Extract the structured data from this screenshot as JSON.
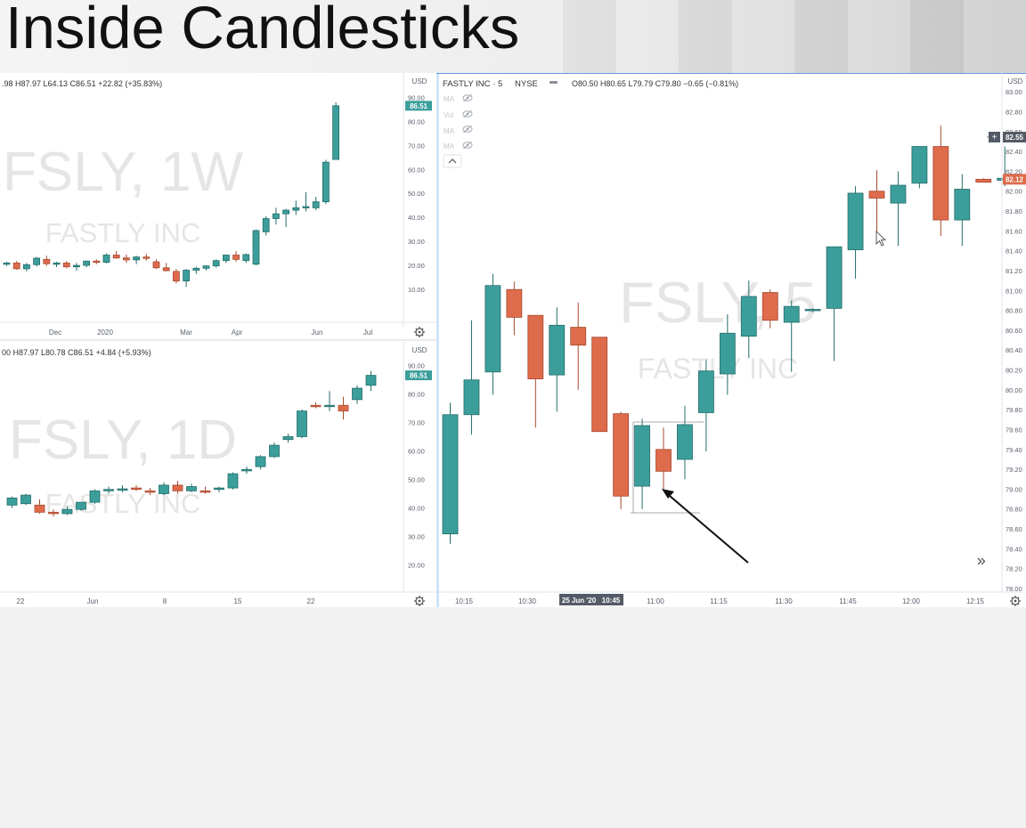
{
  "slide": {
    "title": "Inside Candlesticks"
  },
  "colors": {
    "up": "#3c9e9b",
    "down": "#de6b4b",
    "up_stroke": "#236d6a",
    "down_stroke": "#a84a31",
    "watermark": "#e5e5e5",
    "axis_text": "#59606b",
    "price_tag": "#3c9e9b",
    "current_tag": "#de6b4b",
    "crosshair_tag": "#545b66",
    "arrow": "#111111"
  },
  "panels": {
    "weekly": {
      "legend": ".98 H87.97 L64.13 C86.51 +22.82 (+35.83%)",
      "watermark_symbol": "FSLY, 1W",
      "watermark_name": "FASTLY INC",
      "currency": "USD",
      "price_tag": "86.51",
      "gear_icon": "gear"
    },
    "daily": {
      "legend": "00 H87.97 L80.78 C86.51 +4.84 (+5.93%)",
      "watermark_symbol": "FSLY, 1D",
      "watermark_name": "FASTLY INC",
      "currency": "USD",
      "price_tag": "86.51",
      "gear_icon": "gear"
    },
    "intraday": {
      "symbol": "FASTLY INC · 5",
      "exchange": "NYSE",
      "ohlc": "O80.50 H80.65 L79.79 C79.80 −0.65 (−0.81%)",
      "indicators": [
        "MA",
        "Vol",
        "MA",
        "MA"
      ],
      "watermark_symbol": "FSLY, 5",
      "watermark_name": "FASTLY INC",
      "currency": "USD",
      "crosshair_tag": "82.55",
      "price_tag": "82.12",
      "date_tag": "25 Jun '20",
      "time_tag": "10:45",
      "collapse_icon": "chevron-up",
      "scroll_icon": "double-chevron-right",
      "gear_icon": "gear"
    }
  },
  "chart_data": [
    {
      "type": "candlestick",
      "title": "FSLY, 1W",
      "ylabel": "USD",
      "ylim": [
        0,
        92
      ],
      "yticks": [
        "90.00",
        "80.00",
        "70.00",
        "60.00",
        "50.00",
        "40.00",
        "30.00",
        "20.00",
        "10.00"
      ],
      "xticks": [
        "Dec",
        "2020",
        "Mar",
        "Apr",
        "Jun",
        "Jul"
      ],
      "legend": "none",
      "candles": [
        [
          20.5,
          21.5,
          19.8,
          21.0
        ],
        [
          21.0,
          21.8,
          18.2,
          18.6
        ],
        [
          18.6,
          21.0,
          17.5,
          20.3
        ],
        [
          20.3,
          23.5,
          19.5,
          23.0
        ],
        [
          22.5,
          24.0,
          19.8,
          20.7
        ],
        [
          20.7,
          21.5,
          19.3,
          21.0
        ],
        [
          21.0,
          21.8,
          18.8,
          19.4
        ],
        [
          19.4,
          21.0,
          17.8,
          20.0
        ],
        [
          20.0,
          22.0,
          19.2,
          21.8
        ],
        [
          21.8,
          22.5,
          20.5,
          21.3
        ],
        [
          21.3,
          25.0,
          20.8,
          24.3
        ],
        [
          24.3,
          26.0,
          22.8,
          23.1
        ],
        [
          23.1,
          24.5,
          21.0,
          22.3
        ],
        [
          22.3,
          24.0,
          20.5,
          23.5
        ],
        [
          23.5,
          24.8,
          22.0,
          22.9
        ],
        [
          21.5,
          22.5,
          18.5,
          19.0
        ],
        [
          19.0,
          21.0,
          17.5,
          17.8
        ],
        [
          17.5,
          18.5,
          12.5,
          13.5
        ],
        [
          13.5,
          18.5,
          11.0,
          18.0
        ],
        [
          18.0,
          19.5,
          16.5,
          18.8
        ],
        [
          18.8,
          20.0,
          17.8,
          19.8
        ],
        [
          19.8,
          22.5,
          19.0,
          22.0
        ],
        [
          22.0,
          24.5,
          21.0,
          24.3
        ],
        [
          24.3,
          26.0,
          21.5,
          22.5
        ],
        [
          22.0,
          25.0,
          21.0,
          24.5
        ],
        [
          20.5,
          35.0,
          20.0,
          34.5
        ],
        [
          34.0,
          40.5,
          32.5,
          39.5
        ],
        [
          39.5,
          44.0,
          37.0,
          41.5
        ],
        [
          41.5,
          43.5,
          36.0,
          43.0
        ],
        [
          43.0,
          47.0,
          41.0,
          44.0
        ],
        [
          44.0,
          50.5,
          42.5,
          44.5
        ],
        [
          44.0,
          48.5,
          43.0,
          46.5
        ],
        [
          46.5,
          64.0,
          45.5,
          63.0
        ],
        [
          64.13,
          87.97,
          64.13,
          86.51
        ]
      ]
    },
    {
      "type": "candlestick",
      "title": "FSLY, 1D",
      "ylabel": "USD",
      "ylim": [
        13,
        92
      ],
      "yticks": [
        "90.00",
        "80.00",
        "70.00",
        "60.00",
        "50.00",
        "40.00",
        "30.00",
        "20.00"
      ],
      "xticks": [
        "22",
        "Jun",
        "8",
        "15",
        "22"
      ],
      "legend": "none",
      "candles": [
        [
          41.0,
          44.0,
          40.0,
          43.5
        ],
        [
          41.5,
          45.0,
          41.0,
          44.5
        ],
        [
          41.0,
          43.0,
          38.0,
          38.5
        ],
        [
          38.5,
          39.5,
          37.0,
          38.0
        ],
        [
          38.0,
          40.5,
          37.5,
          39.5
        ],
        [
          39.5,
          42.0,
          39.0,
          42.0
        ],
        [
          42.0,
          46.5,
          41.5,
          46.0
        ],
        [
          46.0,
          47.5,
          45.0,
          46.5
        ],
        [
          46.5,
          48.0,
          45.5,
          46.7
        ],
        [
          47.0,
          48.0,
          46.0,
          46.5
        ],
        [
          46.0,
          47.0,
          44.5,
          45.5
        ],
        [
          45.0,
          49.0,
          44.5,
          48.0
        ],
        [
          48.0,
          49.5,
          45.0,
          46.0
        ],
        [
          46.0,
          48.5,
          45.5,
          47.5
        ],
        [
          46.0,
          47.5,
          45.0,
          45.5
        ],
        [
          46.5,
          47.5,
          45.5,
          47.0
        ],
        [
          47.0,
          52.5,
          46.5,
          52.0
        ],
        [
          53.0,
          54.5,
          52.0,
          53.5
        ],
        [
          54.5,
          58.5,
          53.5,
          58.0
        ],
        [
          58.0,
          63.0,
          57.5,
          62.0
        ],
        [
          64.0,
          66.0,
          63.0,
          65.0
        ],
        [
          65.0,
          74.5,
          64.5,
          74.0
        ],
        [
          76.0,
          77.0,
          75.0,
          75.5
        ],
        [
          76.0,
          81.0,
          74.0,
          76.0
        ],
        [
          76.0,
          79.0,
          71.0,
          74.0
        ],
        [
          78.0,
          83.0,
          76.5,
          82.0
        ],
        [
          83.0,
          87.97,
          81.0,
          86.51
        ]
      ]
    },
    {
      "type": "candlestick",
      "title": "FSLY, 5",
      "ylabel": "USD",
      "ylim": [
        78.0,
        83.1
      ],
      "yticks": [
        "83.00",
        "82.80",
        "82.60",
        "82.40",
        "82.20",
        "82.00",
        "81.80",
        "81.60",
        "81.40",
        "81.20",
        "81.00",
        "80.80",
        "80.60",
        "80.40",
        "80.20",
        "80.00",
        "79.80",
        "79.60",
        "79.40",
        "79.20",
        "79.00",
        "78.80",
        "78.60",
        "78.40",
        "78.20",
        "78.00"
      ],
      "xticks": [
        "10:15",
        "10:30",
        "10:45",
        "11:00",
        "11:15",
        "11:30",
        "11:45",
        "12:00",
        "12:15"
      ],
      "legend": "none",
      "annotation": "arrow pointing to inside candles",
      "candles": [
        [
          78.55,
          79.87,
          78.45,
          79.75
        ],
        [
          79.75,
          80.7,
          79.55,
          80.1
        ],
        [
          80.18,
          81.17,
          79.95,
          81.05
        ],
        [
          81.01,
          81.09,
          80.55,
          80.73
        ],
        [
          80.75,
          80.63,
          79.62,
          80.11
        ],
        [
          80.15,
          80.83,
          79.78,
          80.65
        ],
        [
          80.63,
          80.88,
          80.0,
          80.45
        ],
        [
          80.53,
          80.52,
          79.88,
          79.58
        ],
        [
          79.76,
          79.78,
          78.8,
          78.93
        ],
        [
          79.03,
          79.71,
          78.8,
          79.64
        ],
        [
          79.4,
          79.62,
          78.98,
          79.18
        ],
        [
          79.3,
          79.84,
          79.1,
          79.65
        ],
        [
          79.77,
          80.3,
          79.38,
          80.19
        ],
        [
          80.16,
          80.76,
          79.95,
          80.57
        ],
        [
          80.54,
          81.1,
          80.32,
          80.94
        ],
        [
          80.98,
          81.01,
          80.62,
          80.7
        ],
        [
          80.68,
          80.9,
          80.18,
          80.84
        ],
        [
          80.8,
          80.82,
          80.78,
          80.81
        ],
        [
          80.82,
          81.32,
          80.29,
          81.44
        ],
        [
          81.41,
          82.05,
          81.12,
          81.98
        ],
        [
          82.0,
          82.21,
          81.57,
          81.93
        ],
        [
          81.88,
          82.2,
          81.45,
          82.06
        ],
        [
          82.08,
          82.45,
          82.03,
          82.45
        ],
        [
          82.45,
          82.66,
          81.55,
          81.71
        ],
        [
          81.71,
          82.17,
          81.45,
          82.02
        ],
        [
          82.12,
          82.1,
          82.13,
          82.09
        ],
        [
          82.11,
          82.45,
          82.05,
          82.13
        ]
      ]
    }
  ]
}
